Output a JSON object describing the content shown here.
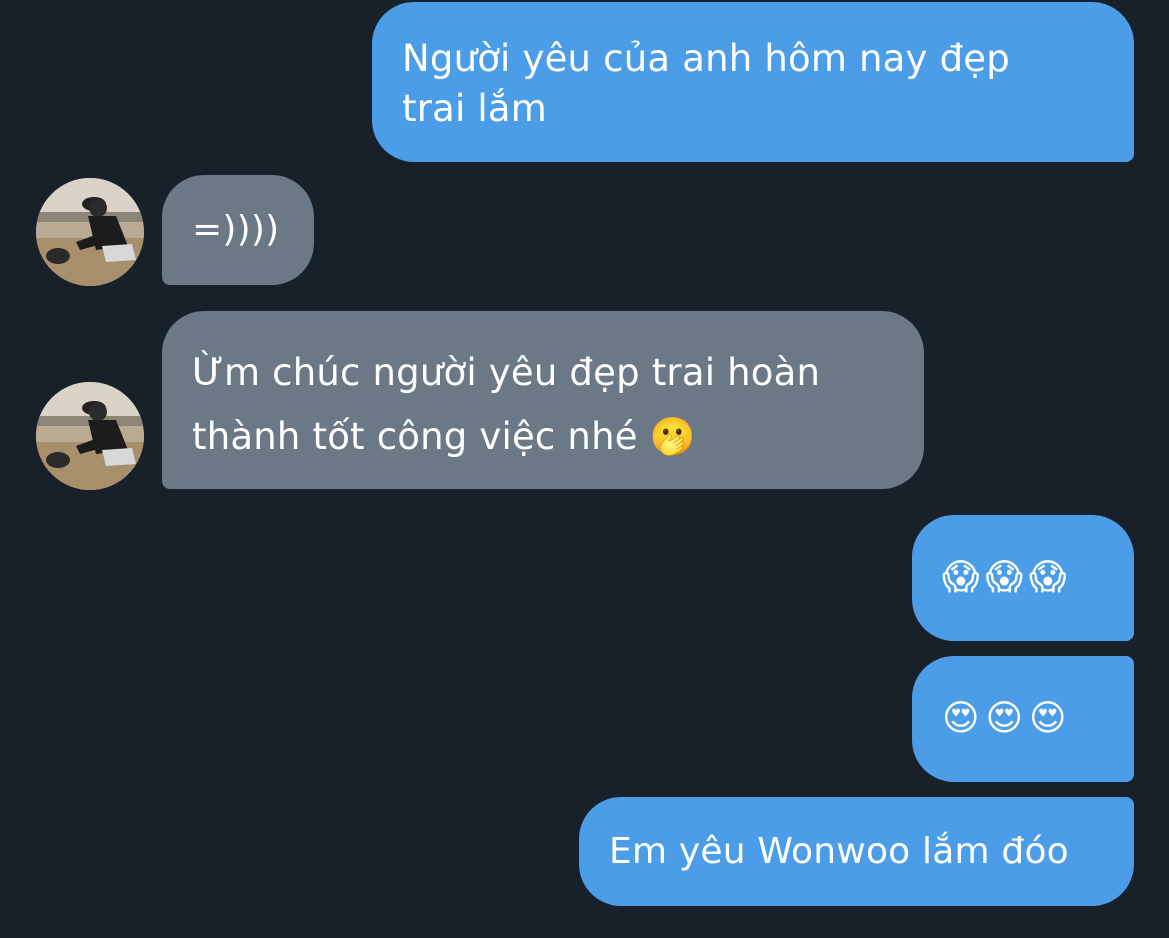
{
  "conversation": {
    "messages": [
      {
        "direction": "outgoing",
        "text": "Người yêu của anh hôm nay đẹp\ntrai lắm"
      },
      {
        "direction": "incoming",
        "text": "=))))"
      },
      {
        "direction": "incoming",
        "text": "Ừm chúc người yêu đẹp trai hoàn\nthành tốt công việc nhé 🫢"
      },
      {
        "direction": "outgoing",
        "text": "😱😱😱"
      },
      {
        "direction": "outgoing",
        "text": "😍😍😍"
      },
      {
        "direction": "outgoing",
        "text": "Em yêu Wonwoo lắm đóo"
      }
    ]
  },
  "colors": {
    "background": "#18202a",
    "outgoing_bubble": "#4c9de8",
    "incoming_bubble": "#6b7886",
    "text": "#ffffff"
  },
  "avatar": {
    "icon": "contact-avatar-photo"
  }
}
